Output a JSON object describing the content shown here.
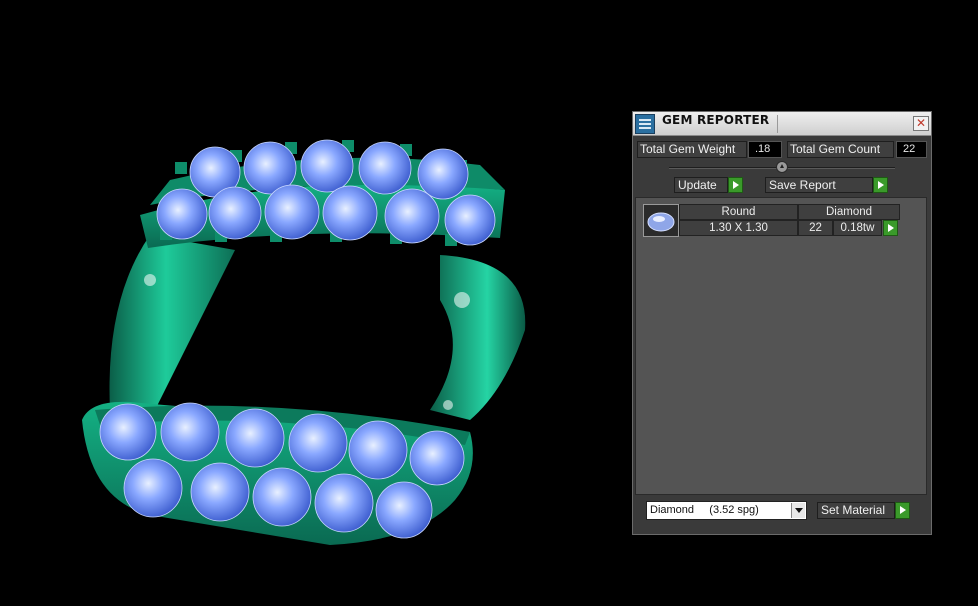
{
  "viewport": {
    "background": "#000000",
    "ring_color": "#13a67f",
    "gem_color": "#8fb0ff"
  },
  "panel": {
    "title": "GEM REPORTER",
    "close_icon": "close-icon",
    "total_gem_weight_label": "Total Gem Weight",
    "total_gem_weight_value": ".18",
    "total_gem_count_label": "Total Gem Count",
    "total_gem_count_value": "22",
    "update_label": "Update",
    "save_report_label": "Save Report",
    "gem_row": {
      "shape": "Round",
      "size": "1.30 X 1.30",
      "material": "Diamond",
      "count": "22",
      "weight": "0.18tw",
      "thumb_icon": "round-gem-icon"
    },
    "material_select_value": "Diamond     (3.52 spg)",
    "set_material_label": "Set Material",
    "accent_green": "#3a9a2a"
  }
}
